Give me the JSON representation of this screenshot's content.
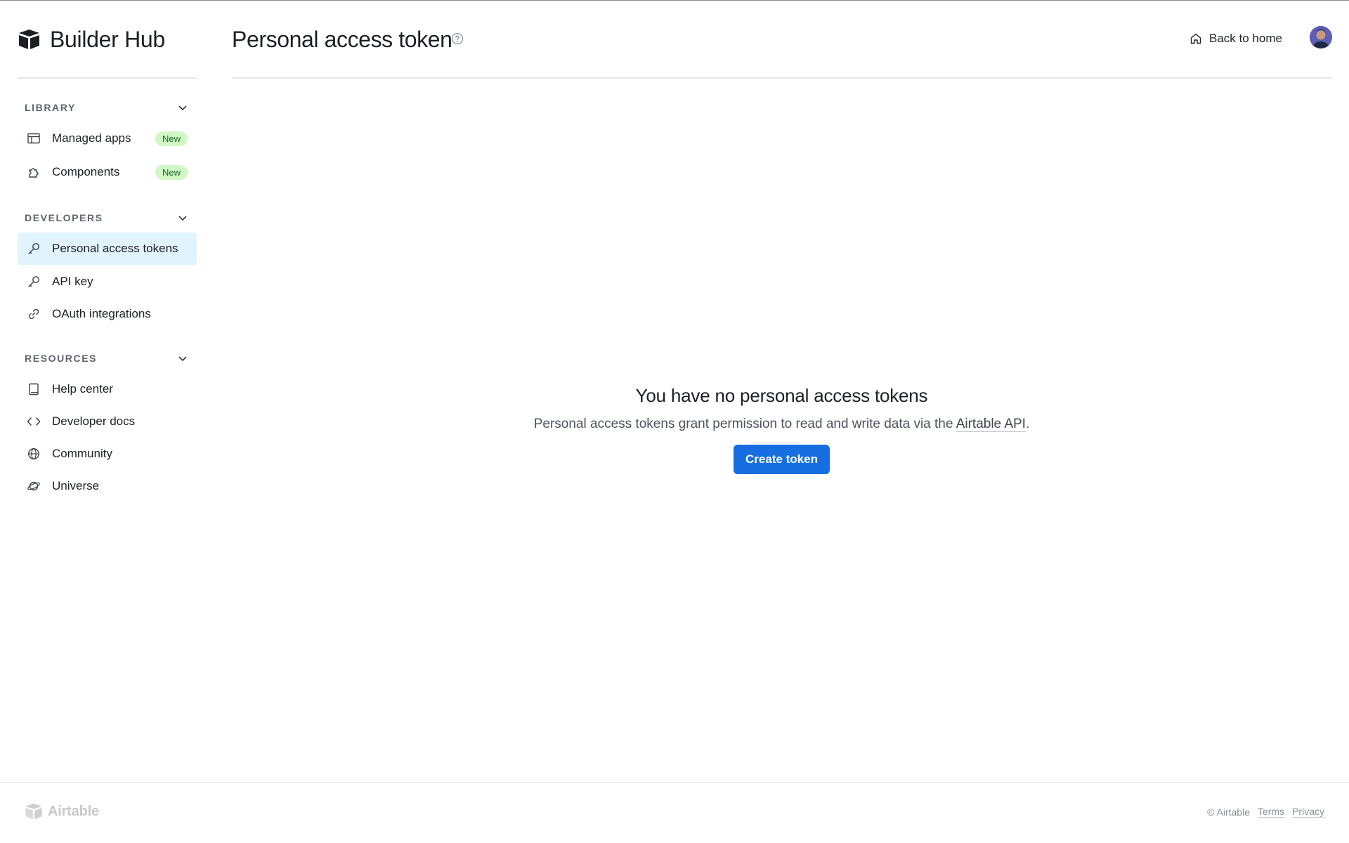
{
  "brand": {
    "name": "Builder Hub"
  },
  "sidebar": {
    "sections": [
      {
        "title": "LIBRARY",
        "items": [
          {
            "label": "Managed apps",
            "icon": "table-icon",
            "badge": "New"
          },
          {
            "label": "Components",
            "icon": "puzzle-icon",
            "badge": "New"
          }
        ]
      },
      {
        "title": "DEVELOPERS",
        "items": [
          {
            "label": "Personal access tokens",
            "icon": "key-icon",
            "active": true
          },
          {
            "label": "API key",
            "icon": "key-icon"
          },
          {
            "label": "OAuth integrations",
            "icon": "link-icon"
          }
        ]
      },
      {
        "title": "RESOURCES",
        "items": [
          {
            "label": "Help center",
            "icon": "book-icon"
          },
          {
            "label": "Developer docs",
            "icon": "code-icon"
          },
          {
            "label": "Community",
            "icon": "globe-icon"
          },
          {
            "label": "Universe",
            "icon": "planet-icon"
          }
        ]
      }
    ]
  },
  "header": {
    "title": "Personal access token",
    "back_home": "Back to home"
  },
  "empty_state": {
    "title": "You have no personal access tokens",
    "description_prefix": "Personal access tokens grant permission to read and write data via the ",
    "link": "Airtable API",
    "description_suffix": ".",
    "button": "Create token"
  },
  "footer": {
    "logo": "Airtable",
    "copyright": "© Airtable",
    "terms": "Terms",
    "privacy": "Privacy"
  },
  "colors": {
    "accent": "#166ee1",
    "active_bg": "#e1f3fd",
    "badge_bg": "#d1f7c4",
    "badge_text": "#1c6a28"
  }
}
